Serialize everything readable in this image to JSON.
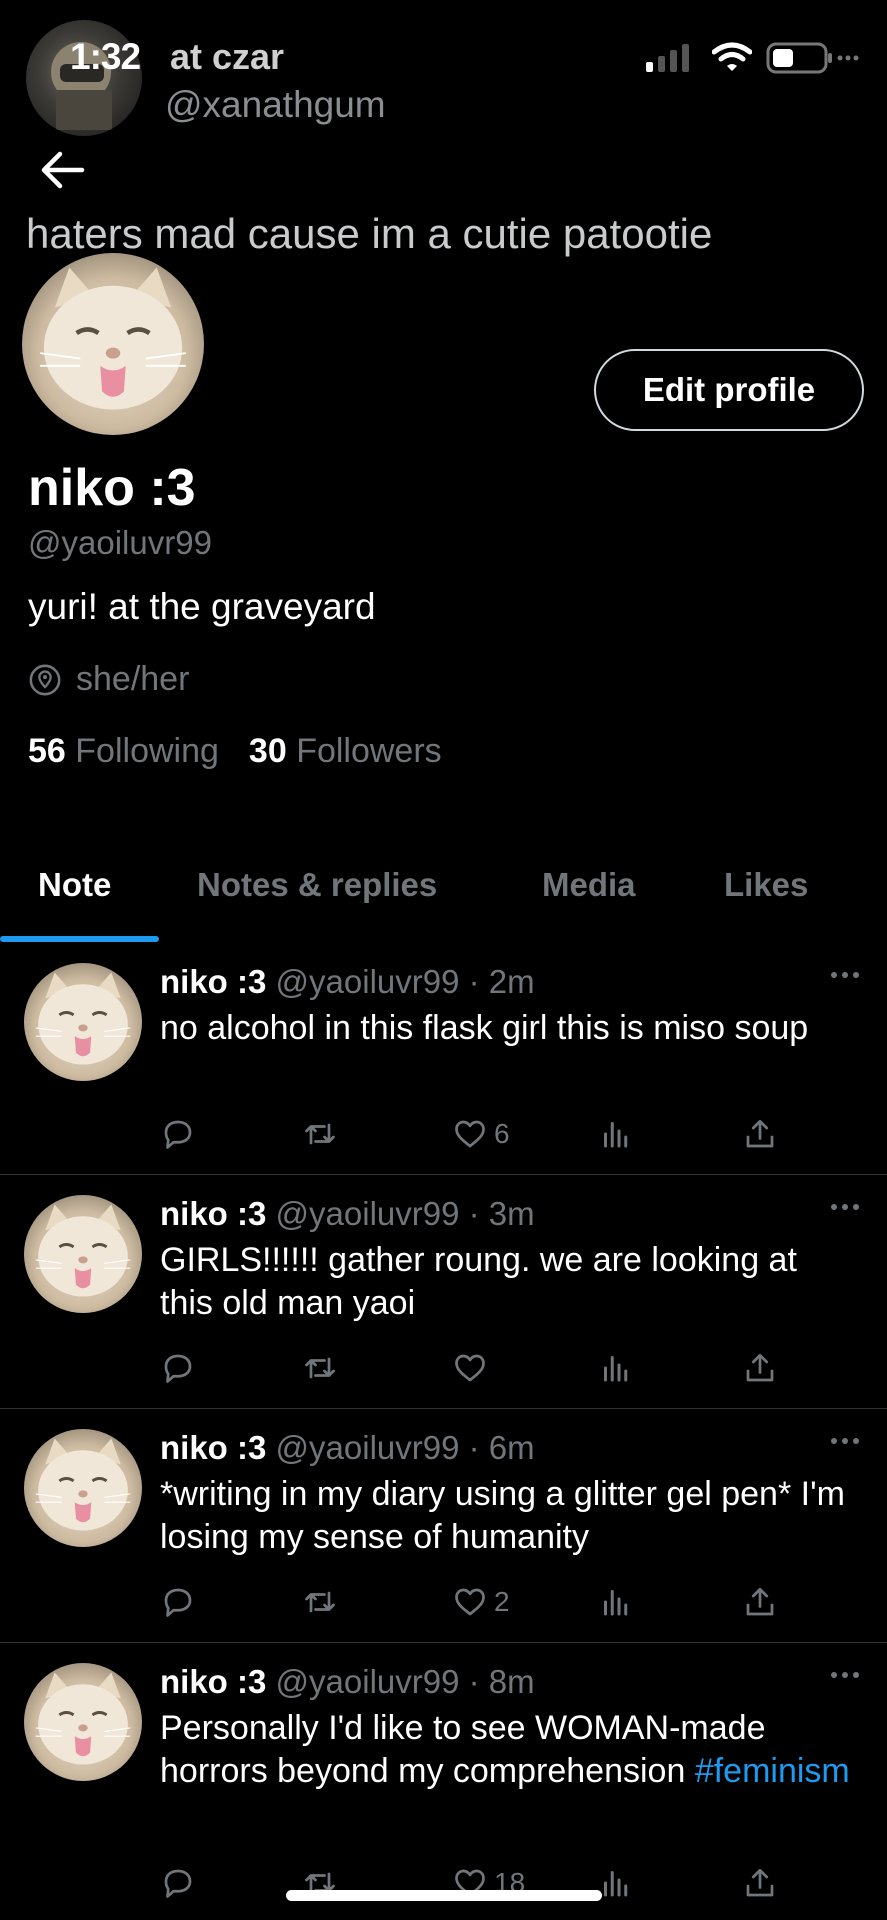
{
  "status_bar": {
    "time": "1:32"
  },
  "header": {
    "name": "at czar",
    "handle": "@xanathgum"
  },
  "tagline": "haters mad cause im a cutie patootie",
  "profile": {
    "edit_label": "Edit profile",
    "display_name": "niko :3",
    "handle": "@yaoiluvr99",
    "bio": "yuri! at the graveyard",
    "location": "she/her",
    "following_count": "56",
    "following_label": "Following",
    "followers_count": "30",
    "followers_label": "Followers"
  },
  "tabs": [
    {
      "label": "Note"
    },
    {
      "label": "Notes & replies"
    },
    {
      "label": "Media"
    },
    {
      "label": "Likes"
    }
  ],
  "tweets": [
    {
      "name": "niko :3",
      "handle": "@yaoiluvr99",
      "time": "· 2m",
      "text": "no alcohol in this flask girl this is miso soup",
      "hashtag": "",
      "likes": "6"
    },
    {
      "name": "niko :3",
      "handle": "@yaoiluvr99",
      "time": "· 3m",
      "text": "GIRLS!!!!!! gather roung. we are looking at this old man yaoi",
      "hashtag": "",
      "likes": ""
    },
    {
      "name": "niko :3",
      "handle": "@yaoiluvr99",
      "time": "· 6m",
      "text": "*writing in my diary using a glitter gel pen* I'm losing my sense of humanity",
      "hashtag": "",
      "likes": "2"
    },
    {
      "name": "niko :3",
      "handle": "@yaoiluvr99",
      "time": "· 8m",
      "text": "Personally I'd like to see WOMAN-made horrors beyond my comprehension",
      "hashtag": "#feminism",
      "likes": "18"
    }
  ],
  "icons": {
    "back": "arrow-left-icon",
    "location": "location-pin-icon",
    "more": "more-icon",
    "reply": "reply-icon",
    "retweet": "retweet-icon",
    "like": "heart-icon",
    "views": "views-icon",
    "share": "share-icon"
  },
  "colors": {
    "accent": "#1d9bf0",
    "background": "#000000",
    "muted": "#71767b"
  }
}
